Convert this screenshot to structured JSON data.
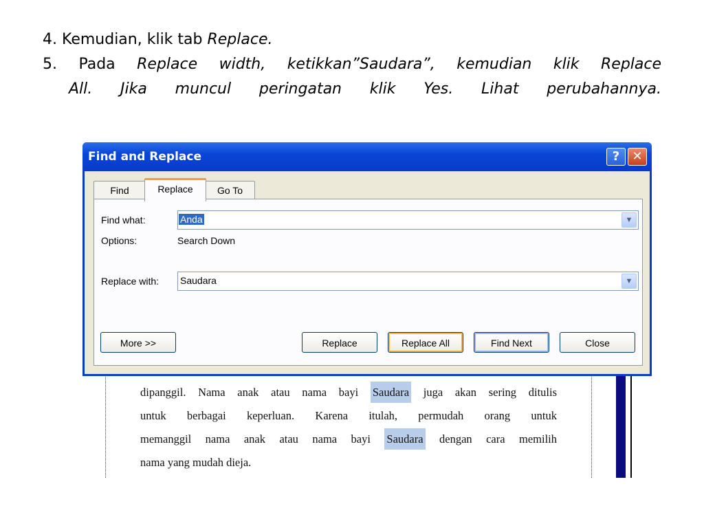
{
  "slide": {
    "step4_prefix": "4. Kemudian, klik tab ",
    "step4_em": "Replace.",
    "step5_prefix": "5. Pada ",
    "step5_em_line1": "Replace width, ketikkan”Saudara”, kemudian klik Replace",
    "step5_em_line2": "All. Jika muncul peringatan klik Yes. Lihat perubahannya."
  },
  "dialog": {
    "title": "Find and Replace",
    "help_label": "?",
    "close_label": "✕",
    "tabs": [
      {
        "label": "Find"
      },
      {
        "label": "Replace"
      },
      {
        "label": "Go To"
      }
    ],
    "find_label": "Find what:",
    "find_value": "Anda",
    "options_label": "Options:",
    "options_value": "Search Down",
    "replace_label": "Replace with:",
    "replace_value": "Saudara",
    "dropdown_glyph": "▼",
    "buttons": {
      "more": "More >>",
      "replace": "Replace",
      "replace_all": "Replace All",
      "find_next": "Find Next",
      "close": "Close"
    }
  },
  "document": {
    "line1_a": "dipanggil. Nama anak atau nama bayi ",
    "line1_hl": "Saudara",
    "line1_b": " juga akan sering ditulis",
    "line2": "untuk berbagai keperluan. Karena itulah, permudah orang untuk",
    "line3_a": "memanggil nama anak atau nama bayi ",
    "line3_hl": "Saudara",
    "line3_b": " dengan cara memilih",
    "line4": "nama yang mudah dieja."
  }
}
